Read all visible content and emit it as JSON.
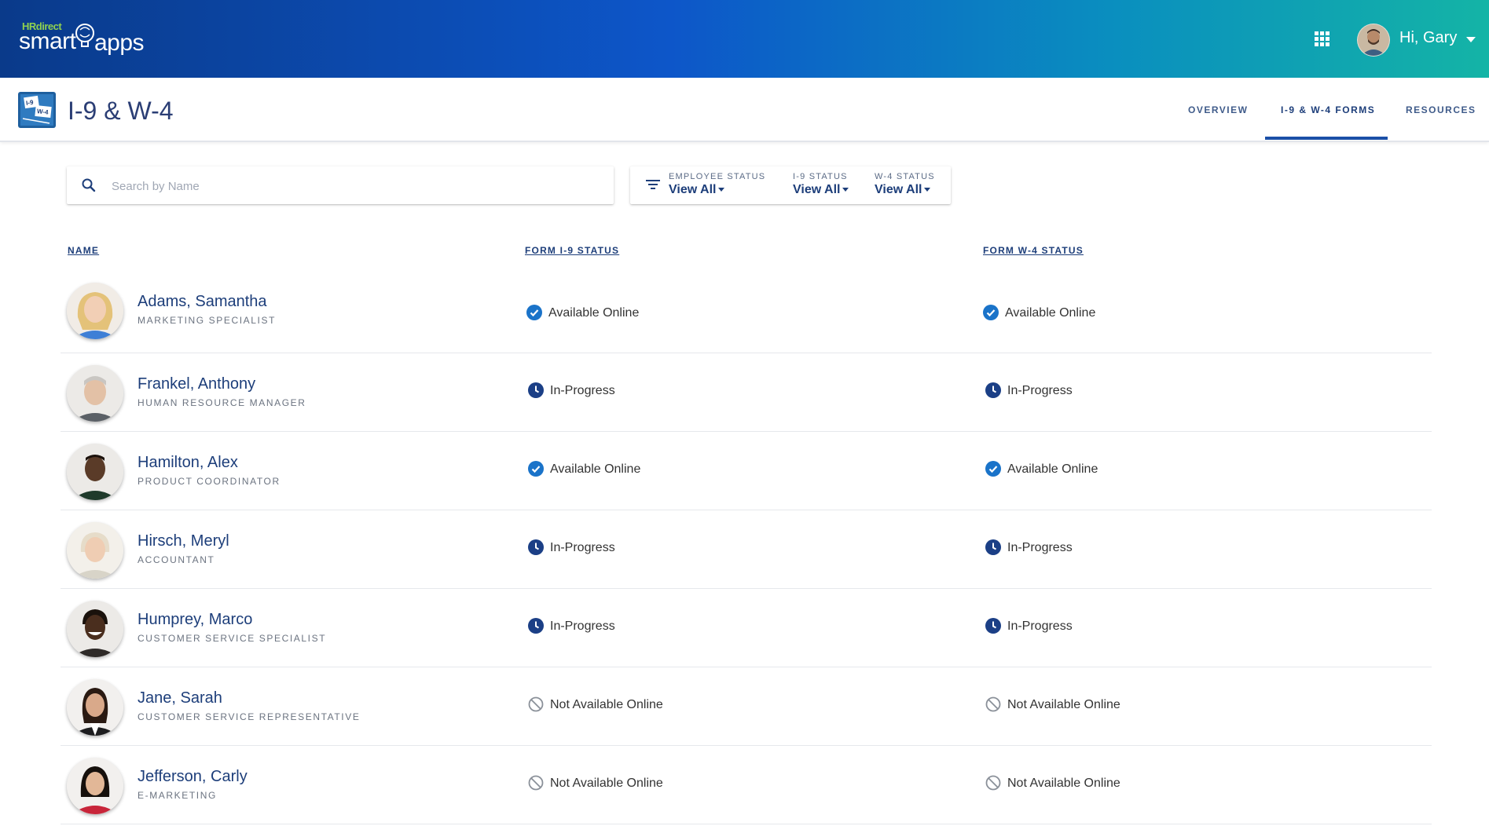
{
  "header": {
    "logo_hr": "HRdirect",
    "logo_smart": "smart",
    "logo_apps": "apps",
    "greeting": "Hi, Gary",
    "grid_icon": "apps-grid-icon"
  },
  "app": {
    "title": "I-9 & W-4",
    "icon_text_top": "I-9",
    "icon_text_bottom": "W-4",
    "nav": [
      {
        "label": "OVERVIEW",
        "active": false
      },
      {
        "label": "I-9 & W-4 FORMS",
        "active": true
      },
      {
        "label": "RESOURCES",
        "active": false
      }
    ]
  },
  "search": {
    "placeholder": "Search by Name",
    "value": ""
  },
  "filters": [
    {
      "label": "EMPLOYEE STATUS",
      "value": "View All"
    },
    {
      "label": "I-9 STATUS",
      "value": "View All"
    },
    {
      "label": "W-4 STATUS",
      "value": "View All"
    }
  ],
  "table": {
    "columns": [
      "NAME",
      "FORM I-9 STATUS",
      "FORM W-4 STATUS"
    ],
    "rows": [
      {
        "name": "Adams, Samantha",
        "title": "MARKETING SPECIALIST",
        "i9": "Available Online",
        "w4": "Available Online",
        "i9_icon": "check-circle-icon",
        "w4_icon": "check-circle-icon"
      },
      {
        "name": "Frankel, Anthony",
        "title": "HUMAN RESOURCE MANAGER",
        "i9": "In-Progress",
        "w4": "In-Progress",
        "i9_icon": "clock-icon",
        "w4_icon": "clock-icon"
      },
      {
        "name": "Hamilton, Alex",
        "title": "PRODUCT COORDINATOR",
        "i9": "Available Online",
        "w4": "Available Online",
        "i9_icon": "check-circle-icon",
        "w4_icon": "check-circle-icon"
      },
      {
        "name": "Hirsch, Meryl",
        "title": "ACCOUNTANT",
        "i9": "In-Progress",
        "w4": "In-Progress",
        "i9_icon": "clock-icon",
        "w4_icon": "clock-icon"
      },
      {
        "name": "Humprey, Marco",
        "title": "CUSTOMER SERVICE SPECIALIST",
        "i9": "In-Progress",
        "w4": "In-Progress",
        "i9_icon": "clock-icon",
        "w4_icon": "clock-icon"
      },
      {
        "name": "Jane, Sarah",
        "title": "CUSTOMER SERVICE REPRESENTATIVE",
        "i9": "Not Available Online",
        "w4": "Not Available Online",
        "i9_icon": "not-available-icon",
        "w4_icon": "not-available-icon"
      },
      {
        "name": "Jefferson, Carly",
        "title": "E-MARKETING",
        "i9": "Not Available Online",
        "w4": "Not Available Online",
        "i9_icon": "not-available-icon",
        "w4_icon": "not-available-icon"
      }
    ]
  },
  "colors": {
    "brand_dark": "#0a3a8a",
    "brand_teal": "#14b4a6",
    "link_blue": "#1d3e7a",
    "check_blue": "#1a73c9",
    "clock_navy": "#1b3f86",
    "muted_gray": "#8a9099"
  }
}
